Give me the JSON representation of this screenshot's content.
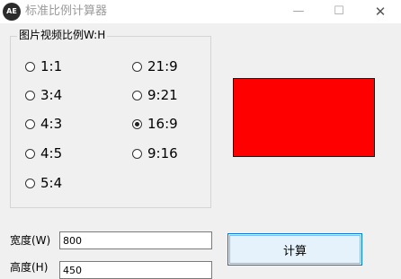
{
  "window": {
    "title": "标准比例计算器",
    "icon": "app-logo-icon",
    "icon_text": "AE",
    "controls": {
      "minimize": "—",
      "maximize": "☐",
      "close": "✕"
    }
  },
  "ratio_group": {
    "legend": "图片视频比例W:H",
    "options": [
      {
        "label": "1:1",
        "checked": false
      },
      {
        "label": "3:4",
        "checked": false
      },
      {
        "label": "4:3",
        "checked": false
      },
      {
        "label": "4:5",
        "checked": false
      },
      {
        "label": "5:4",
        "checked": false
      },
      {
        "label": "21:9",
        "checked": false
      },
      {
        "label": "9:21",
        "checked": false
      },
      {
        "label": "16:9",
        "checked": true
      },
      {
        "label": "9:16",
        "checked": false
      }
    ]
  },
  "preview": {
    "color": "#ff0000"
  },
  "width_field": {
    "label": "宽度(W)",
    "value": "800"
  },
  "height_field": {
    "label": "高度(H)",
    "value": "450"
  },
  "calculate_button": {
    "label": "计算"
  }
}
